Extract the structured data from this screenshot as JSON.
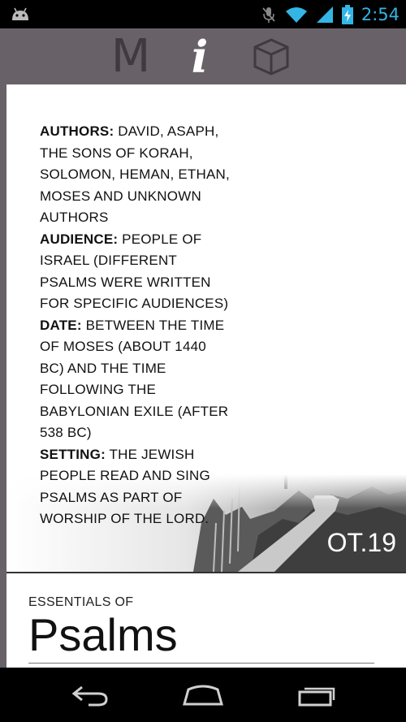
{
  "status_bar": {
    "time": "2:54",
    "icons": [
      "android-icon",
      "mute-icon",
      "wifi-icon",
      "signal-icon",
      "battery-charging-icon"
    ]
  },
  "toolbar": {
    "m_label": "M",
    "info_label": "i",
    "box_icon": "cube-icon"
  },
  "info": {
    "authors_label": "AUTHORS:",
    "authors_text": " DAVID, ASAPH, THE SONS OF KORAH, SOLOMON, HEMAN, ETHAN, MOSES AND UNKNOWN AUTHORS",
    "audience_label": "AUDIENCE:",
    "audience_text": " PEOPLE OF ISRAEL (DIFFERENT PSALMS WERE WRITTEN FOR SPECIFIC AUDIENCES)",
    "date_label": "DATE:",
    "date_text": " BETWEEN THE TIME OF MOSES (ABOUT 1440 BC) AND THE TIME FOLLOWING THE BABYLONIAN EXILE (AFTER 538 BC)",
    "setting_label": "SETTING:",
    "setting_text": " THE JEWISH PEOPLE READ AND SING PSALMS AS PART OF WORSHIP OF THE LORD."
  },
  "badge": "OT.19",
  "essentials_label": "ESSENTIALS OF",
  "book_title": "Psalms",
  "nav": {
    "back_icon": "back-icon",
    "home_icon": "home-icon",
    "recents_icon": "recent-apps-icon"
  }
}
